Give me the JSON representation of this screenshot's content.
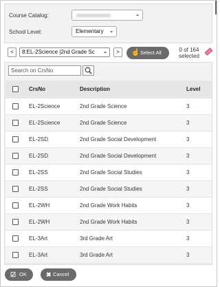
{
  "filters": {
    "course_catalog_label": "Course Catalog:",
    "school_level_label": "School Level:",
    "school_level_value": "Elementary"
  },
  "nav": {
    "prev_label": "<",
    "next_label": ">",
    "selected_course": "8:EL-2Science |2nd Grade Sc",
    "select_all_label": "Select All",
    "selection_count": "0 of 164",
    "selection_suffix": "selected"
  },
  "search": {
    "placeholder": "Search on CrsNo"
  },
  "table": {
    "columns": [
      "CrsNo",
      "Description",
      "Level"
    ],
    "rows": [
      {
        "crsno": "EL-2Science",
        "desc": "2nd Grade Science",
        "level": "3"
      },
      {
        "crsno": "EL-2Science",
        "desc": "2nd Grade Science",
        "level": "3"
      },
      {
        "crsno": "EL-2SD",
        "desc": "2nd Grade Social Development",
        "level": "3"
      },
      {
        "crsno": "EL-2SD",
        "desc": "2nd Grade Social Development",
        "level": "3"
      },
      {
        "crsno": "EL-2SS",
        "desc": "2nd Grade Social Studies",
        "level": "3"
      },
      {
        "crsno": "EL-2SS",
        "desc": "2nd Grade Social Studies",
        "level": "3"
      },
      {
        "crsno": "EL-2WH",
        "desc": "2nd Grade Work Habits",
        "level": "3"
      },
      {
        "crsno": "EL-2WH",
        "desc": "2nd Grade Work Habits",
        "level": "3"
      },
      {
        "crsno": "EL-3Art",
        "desc": "3rd Grade Art",
        "level": "3"
      },
      {
        "crsno": "EL-3Art",
        "desc": "3rd Grade Art",
        "level": "3"
      }
    ]
  },
  "footer": {
    "ok_label": "OK",
    "cancel_label": "Cancel"
  },
  "icons": {
    "hand": "hand-pointer-icon",
    "eraser": "eraser-icon",
    "search": "search-icon",
    "ok": "checkbox-check-icon",
    "cancel": "close-icon"
  }
}
